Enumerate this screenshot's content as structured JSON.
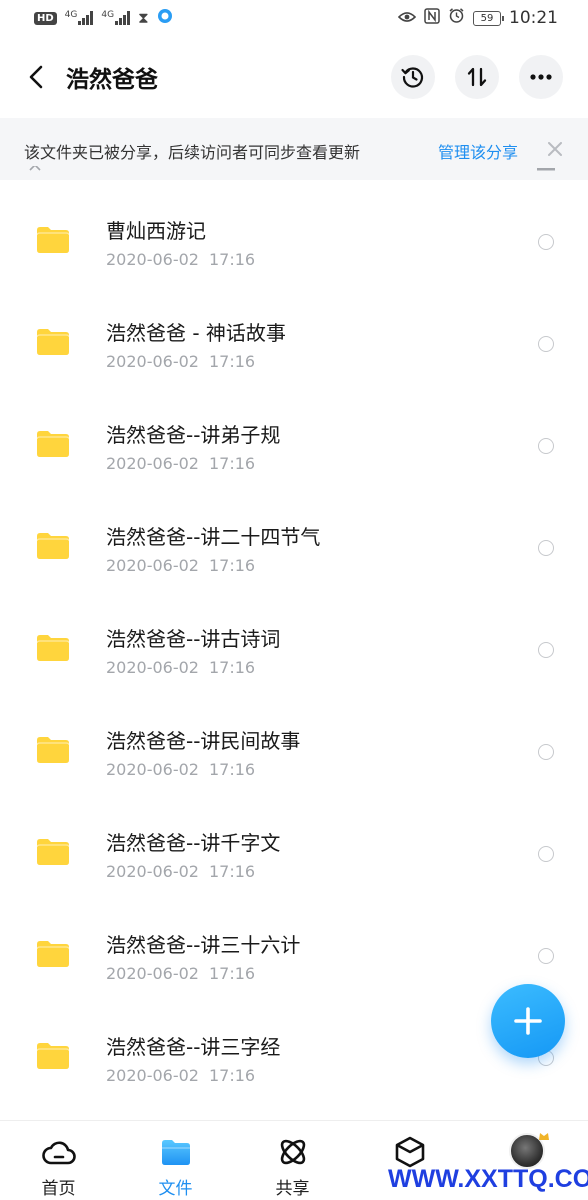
{
  "status_bar": {
    "hd": "HD",
    "net1": "4G",
    "net2": "4G",
    "battery": "59",
    "time": "10:21"
  },
  "header": {
    "title": "浩然爸爸"
  },
  "banner": {
    "text": "该文件夹已被分享，后续访问者可同步查看更新",
    "link": "管理该分享"
  },
  "files": [
    {
      "name": "曹灿西游记",
      "date": "2020-06-02",
      "time": "17:16"
    },
    {
      "name": "浩然爸爸 - 神话故事",
      "date": "2020-06-02",
      "time": "17:16"
    },
    {
      "name": "浩然爸爸--讲弟子规",
      "date": "2020-06-02",
      "time": "17:16"
    },
    {
      "name": "浩然爸爸--讲二十四节气",
      "date": "2020-06-02",
      "time": "17:16"
    },
    {
      "name": "浩然爸爸--讲古诗词",
      "date": "2020-06-02",
      "time": "17:16"
    },
    {
      "name": "浩然爸爸--讲民间故事",
      "date": "2020-06-02",
      "time": "17:16"
    },
    {
      "name": "浩然爸爸--讲千字文",
      "date": "2020-06-02",
      "time": "17:16"
    },
    {
      "name": "浩然爸爸--讲三十六计",
      "date": "2020-06-02",
      "time": "17:16"
    },
    {
      "name": "浩然爸爸--讲三字经",
      "date": "2020-06-02",
      "time": "17:16"
    }
  ],
  "nav": {
    "home": "首页",
    "files": "文件",
    "share": "共享"
  },
  "watermark": "WWW.XXTTQ.COM",
  "colors": {
    "accent": "#1f8ff0",
    "folder": "#ffd53d",
    "fab_start": "#3cbcff",
    "fab_end": "#1598f5"
  },
  "icons": {
    "back": "chevron-left-icon",
    "history": "history-icon",
    "sort": "sort-icon",
    "more": "more-horizontal-icon",
    "close": "close-icon",
    "folder": "folder-icon",
    "fab": "plus-icon",
    "nav_home": "cloud-icon",
    "nav_files": "folder-icon",
    "nav_share": "atom-icon",
    "nav_discover": "cube-icon"
  }
}
